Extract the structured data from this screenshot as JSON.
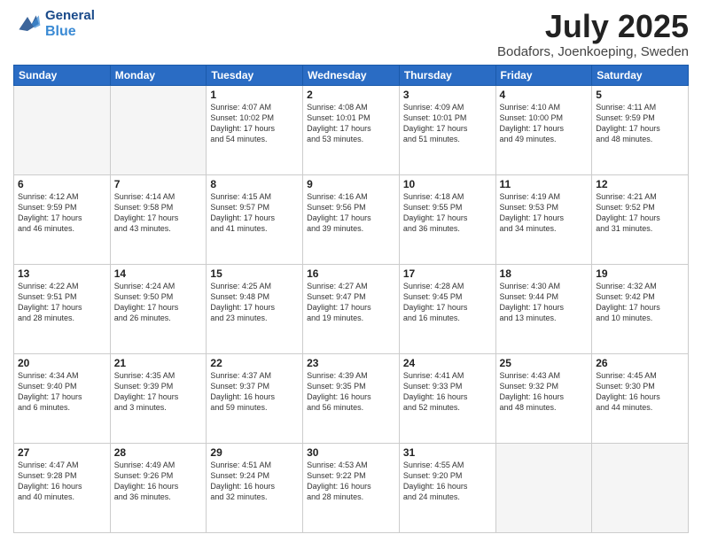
{
  "logo": {
    "line1": "General",
    "line2": "Blue"
  },
  "title": "July 2025",
  "location": "Bodafors, Joenkoeping, Sweden",
  "days_header": [
    "Sunday",
    "Monday",
    "Tuesday",
    "Wednesday",
    "Thursday",
    "Friday",
    "Saturday"
  ],
  "weeks": [
    [
      {
        "num": "",
        "info": ""
      },
      {
        "num": "",
        "info": ""
      },
      {
        "num": "1",
        "info": "Sunrise: 4:07 AM\nSunset: 10:02 PM\nDaylight: 17 hours\nand 54 minutes."
      },
      {
        "num": "2",
        "info": "Sunrise: 4:08 AM\nSunset: 10:01 PM\nDaylight: 17 hours\nand 53 minutes."
      },
      {
        "num": "3",
        "info": "Sunrise: 4:09 AM\nSunset: 10:01 PM\nDaylight: 17 hours\nand 51 minutes."
      },
      {
        "num": "4",
        "info": "Sunrise: 4:10 AM\nSunset: 10:00 PM\nDaylight: 17 hours\nand 49 minutes."
      },
      {
        "num": "5",
        "info": "Sunrise: 4:11 AM\nSunset: 9:59 PM\nDaylight: 17 hours\nand 48 minutes."
      }
    ],
    [
      {
        "num": "6",
        "info": "Sunrise: 4:12 AM\nSunset: 9:59 PM\nDaylight: 17 hours\nand 46 minutes."
      },
      {
        "num": "7",
        "info": "Sunrise: 4:14 AM\nSunset: 9:58 PM\nDaylight: 17 hours\nand 43 minutes."
      },
      {
        "num": "8",
        "info": "Sunrise: 4:15 AM\nSunset: 9:57 PM\nDaylight: 17 hours\nand 41 minutes."
      },
      {
        "num": "9",
        "info": "Sunrise: 4:16 AM\nSunset: 9:56 PM\nDaylight: 17 hours\nand 39 minutes."
      },
      {
        "num": "10",
        "info": "Sunrise: 4:18 AM\nSunset: 9:55 PM\nDaylight: 17 hours\nand 36 minutes."
      },
      {
        "num": "11",
        "info": "Sunrise: 4:19 AM\nSunset: 9:53 PM\nDaylight: 17 hours\nand 34 minutes."
      },
      {
        "num": "12",
        "info": "Sunrise: 4:21 AM\nSunset: 9:52 PM\nDaylight: 17 hours\nand 31 minutes."
      }
    ],
    [
      {
        "num": "13",
        "info": "Sunrise: 4:22 AM\nSunset: 9:51 PM\nDaylight: 17 hours\nand 28 minutes."
      },
      {
        "num": "14",
        "info": "Sunrise: 4:24 AM\nSunset: 9:50 PM\nDaylight: 17 hours\nand 26 minutes."
      },
      {
        "num": "15",
        "info": "Sunrise: 4:25 AM\nSunset: 9:48 PM\nDaylight: 17 hours\nand 23 minutes."
      },
      {
        "num": "16",
        "info": "Sunrise: 4:27 AM\nSunset: 9:47 PM\nDaylight: 17 hours\nand 19 minutes."
      },
      {
        "num": "17",
        "info": "Sunrise: 4:28 AM\nSunset: 9:45 PM\nDaylight: 17 hours\nand 16 minutes."
      },
      {
        "num": "18",
        "info": "Sunrise: 4:30 AM\nSunset: 9:44 PM\nDaylight: 17 hours\nand 13 minutes."
      },
      {
        "num": "19",
        "info": "Sunrise: 4:32 AM\nSunset: 9:42 PM\nDaylight: 17 hours\nand 10 minutes."
      }
    ],
    [
      {
        "num": "20",
        "info": "Sunrise: 4:34 AM\nSunset: 9:40 PM\nDaylight: 17 hours\nand 6 minutes."
      },
      {
        "num": "21",
        "info": "Sunrise: 4:35 AM\nSunset: 9:39 PM\nDaylight: 17 hours\nand 3 minutes."
      },
      {
        "num": "22",
        "info": "Sunrise: 4:37 AM\nSunset: 9:37 PM\nDaylight: 16 hours\nand 59 minutes."
      },
      {
        "num": "23",
        "info": "Sunrise: 4:39 AM\nSunset: 9:35 PM\nDaylight: 16 hours\nand 56 minutes."
      },
      {
        "num": "24",
        "info": "Sunrise: 4:41 AM\nSunset: 9:33 PM\nDaylight: 16 hours\nand 52 minutes."
      },
      {
        "num": "25",
        "info": "Sunrise: 4:43 AM\nSunset: 9:32 PM\nDaylight: 16 hours\nand 48 minutes."
      },
      {
        "num": "26",
        "info": "Sunrise: 4:45 AM\nSunset: 9:30 PM\nDaylight: 16 hours\nand 44 minutes."
      }
    ],
    [
      {
        "num": "27",
        "info": "Sunrise: 4:47 AM\nSunset: 9:28 PM\nDaylight: 16 hours\nand 40 minutes."
      },
      {
        "num": "28",
        "info": "Sunrise: 4:49 AM\nSunset: 9:26 PM\nDaylight: 16 hours\nand 36 minutes."
      },
      {
        "num": "29",
        "info": "Sunrise: 4:51 AM\nSunset: 9:24 PM\nDaylight: 16 hours\nand 32 minutes."
      },
      {
        "num": "30",
        "info": "Sunrise: 4:53 AM\nSunset: 9:22 PM\nDaylight: 16 hours\nand 28 minutes."
      },
      {
        "num": "31",
        "info": "Sunrise: 4:55 AM\nSunset: 9:20 PM\nDaylight: 16 hours\nand 24 minutes."
      },
      {
        "num": "",
        "info": ""
      },
      {
        "num": "",
        "info": ""
      }
    ]
  ]
}
